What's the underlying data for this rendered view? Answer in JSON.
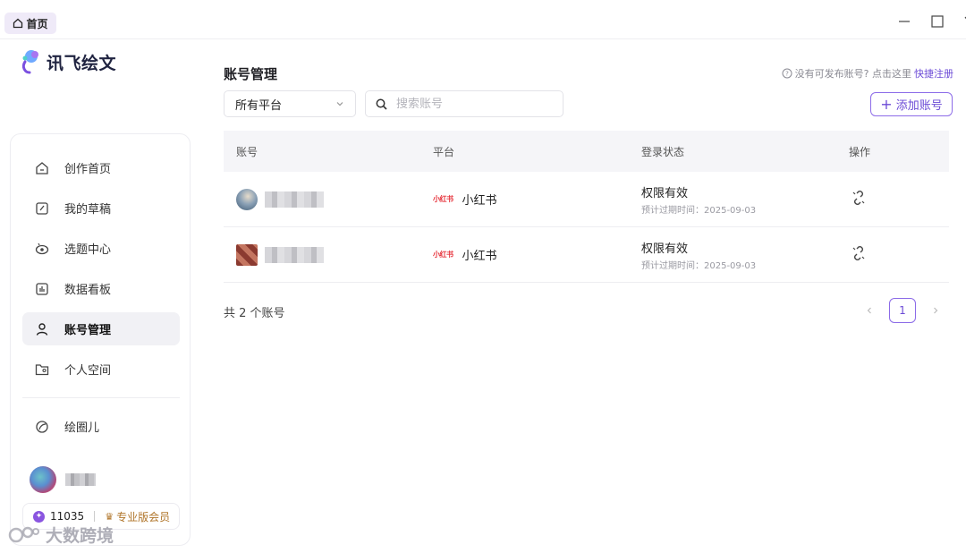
{
  "window": {
    "tab_label": "首页"
  },
  "logo": {
    "text": "讯飞绘文"
  },
  "sidebar": {
    "items": [
      {
        "label": "创作首页",
        "icon": "home-icon"
      },
      {
        "label": "我的草稿",
        "icon": "edit-icon"
      },
      {
        "label": "选题中心",
        "icon": "eye-icon"
      },
      {
        "label": "数据看板",
        "icon": "chart-icon"
      },
      {
        "label": "账号管理",
        "icon": "user-icon",
        "active": true
      },
      {
        "label": "个人空间",
        "icon": "folder-user-icon"
      },
      {
        "label": "绘圈儿",
        "icon": "leaf-icon"
      }
    ],
    "points": "11035",
    "membership": "专业版会员"
  },
  "main": {
    "title": "账号管理",
    "hint_text": "没有可发布账号? 点击这里",
    "hint_link": "快捷注册",
    "platform_select": "所有平台",
    "search_placeholder": "搜索账号",
    "add_button": "添加账号",
    "table": {
      "headers": [
        "账号",
        "平台",
        "登录状态",
        "操作"
      ],
      "rows": [
        {
          "platform_logo": "小红书",
          "platform": "小红书",
          "status": "权限有效",
          "expiry": "预计过期时间：2025-09-03"
        },
        {
          "platform_logo": "小红书",
          "platform": "小红书",
          "status": "权限有效",
          "expiry": "预计过期时间：2025-09-03"
        }
      ]
    },
    "total": "共 2 个账号",
    "current_page": "1"
  },
  "watermark": "大数跨境",
  "colors": {
    "accent": "#6b4ad6",
    "xiaohongshu": "#e6323b"
  }
}
